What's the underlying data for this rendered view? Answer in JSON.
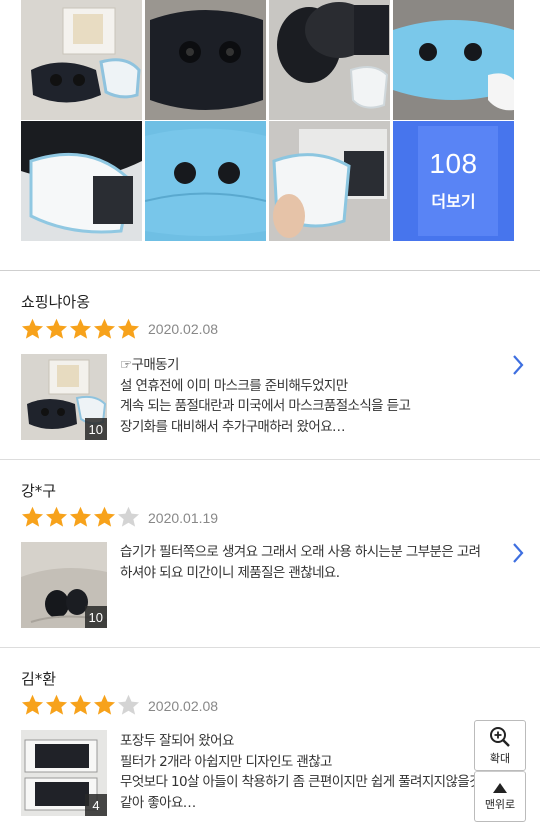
{
  "photo_grid": {
    "more_count": "108",
    "more_label": "더보기"
  },
  "reviews": [
    {
      "reviewer": "쇼핑냐아옹",
      "rating": 5,
      "date": "2020.02.08",
      "photo_count": "10",
      "lines": [
        "☞구매동기",
        "설 연휴전에 이미 마스크를 준비해두었지만",
        "계속 되는 품절대란과 미국에서 마스크품절소식을 듣고",
        "장기화를 대비해서 추가구매하러 왔어요…"
      ]
    },
    {
      "reviewer": "강*구",
      "rating": 4,
      "date": "2020.01.19",
      "photo_count": "10",
      "lines": [
        "습기가 필터쪽으로 생겨요 그래서 오래 사용 하시는분 그부분은 고려",
        "하셔야 되요 미간이니 제품질은 괜찮네요."
      ]
    },
    {
      "reviewer": "김*환",
      "rating": 4,
      "date": "2020.02.08",
      "photo_count": "4",
      "lines": [
        "포장두 잘되어 왔어요",
        "필터가 2개라 아쉽지만 디자인도 괜찮고",
        "무엇보다 10살 아들이 착용하기 좀 큰편이지만 쉽게 풀려지지않을것",
        "같아 좋아요…"
      ]
    }
  ],
  "floating": {
    "zoom_label": "확대",
    "top_label": "맨위로"
  },
  "colors": {
    "star_on": "#f7a21b",
    "star_off": "#d4d4d4",
    "more_overlay": "#3c6ef5",
    "chevron": "#3e6fe0"
  }
}
